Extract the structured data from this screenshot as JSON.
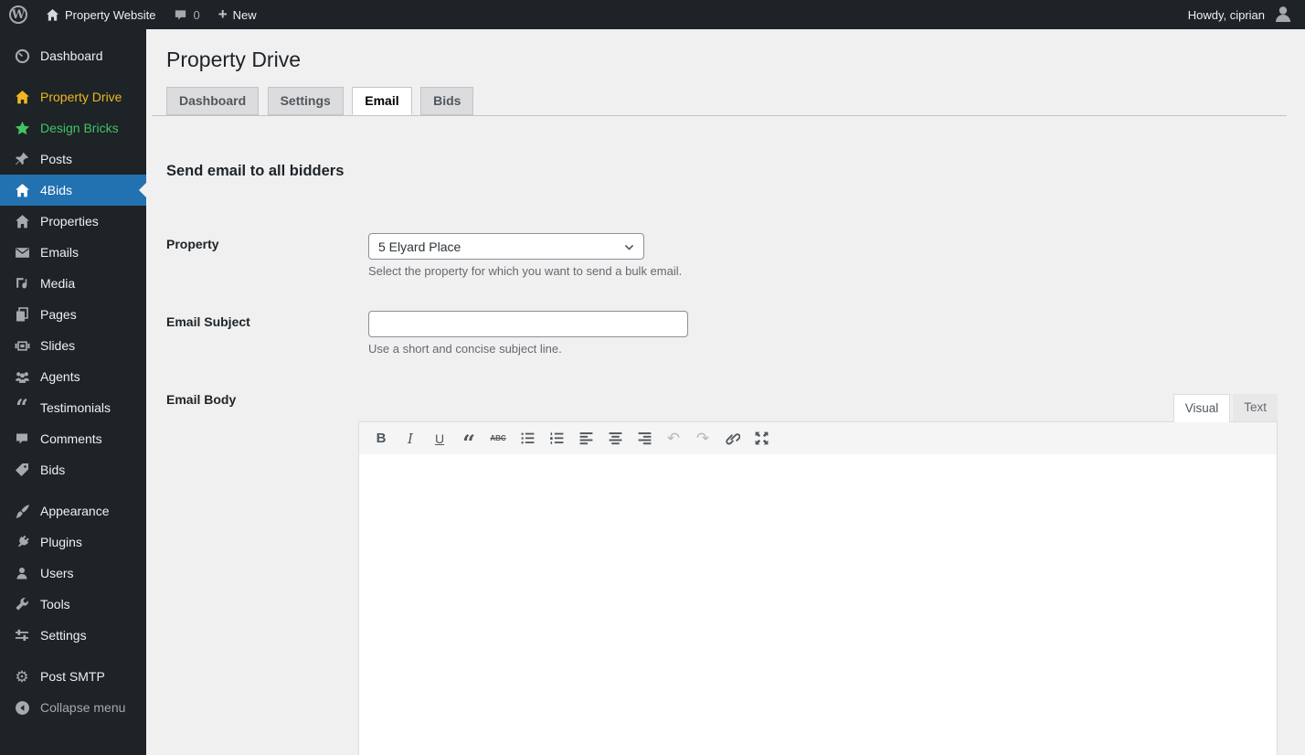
{
  "admin_bar": {
    "logo_letter": "W",
    "site_name": "Property Website",
    "comments_count": "0",
    "new_label": "New",
    "howdy": "Howdy, ciprian"
  },
  "sidebar": {
    "items": [
      {
        "label": "Dashboard",
        "icon": "dashboard-icon"
      },
      {
        "label": "Property Drive",
        "icon": "house-icon",
        "color": "#f0b71e"
      },
      {
        "label": "Design Bricks",
        "icon": "star-icon",
        "color": "#41c463"
      },
      {
        "label": "Posts",
        "icon": "pushpin-icon"
      },
      {
        "label": "4Bids",
        "icon": "house-icon",
        "active": true
      },
      {
        "label": "Properties",
        "icon": "house-icon"
      },
      {
        "label": "Emails",
        "icon": "envelope-icon"
      },
      {
        "label": "Media",
        "icon": "media-icon"
      },
      {
        "label": "Pages",
        "icon": "pages-icon"
      },
      {
        "label": "Slides",
        "icon": "slides-icon"
      },
      {
        "label": "Agents",
        "icon": "groups-icon"
      },
      {
        "label": "Testimonials",
        "icon": "quote-icon"
      },
      {
        "label": "Comments",
        "icon": "comment-icon"
      },
      {
        "label": "Bids",
        "icon": "tag-icon"
      },
      {
        "label": "Appearance",
        "icon": "brush-icon"
      },
      {
        "label": "Plugins",
        "icon": "plugin-icon"
      },
      {
        "label": "Users",
        "icon": "user-icon"
      },
      {
        "label": "Tools",
        "icon": "wrench-icon"
      },
      {
        "label": "Settings",
        "icon": "sliders-icon"
      },
      {
        "label": "Post SMTP",
        "icon": "gear-icon"
      },
      {
        "label": "Collapse menu",
        "icon": "collapse-icon",
        "dim": true
      }
    ],
    "quote_glyph": "“",
    "gear_glyph": "⚙"
  },
  "page": {
    "title": "Property Drive",
    "tabs": [
      {
        "label": "Dashboard",
        "active": false
      },
      {
        "label": "Settings",
        "active": false
      },
      {
        "label": "Email",
        "active": true
      },
      {
        "label": "Bids",
        "active": false
      }
    ],
    "section_heading": "Send email to all bidders",
    "form": {
      "property": {
        "label": "Property",
        "value": "5 Elyard Place",
        "description": "Select the property for which you want to send a bulk email."
      },
      "email_subject": {
        "label": "Email Subject",
        "value": "",
        "description": "Use a short and concise subject line."
      },
      "email_body": {
        "label": "Email Body",
        "value": ""
      }
    },
    "editor": {
      "tabs": [
        {
          "label": "Visual",
          "active": true
        },
        {
          "label": "Text",
          "active": false
        }
      ],
      "toolbar_glyphs": {
        "bold": "B",
        "italic": "I",
        "underline": "U",
        "blockquote": "“",
        "strikethrough": "ABC",
        "undo": "↶",
        "redo": "↷"
      }
    }
  },
  "colors": {
    "admin_bar_bg": "#1d2327",
    "sidebar_bg": "#1d2327",
    "content_bg": "#f0f0f1",
    "accent_blue": "#2271b1",
    "highlight_yellow": "#f0b71e",
    "highlight_green": "#41c463",
    "input_border": "#8c8f94",
    "muted_text": "#646970"
  }
}
